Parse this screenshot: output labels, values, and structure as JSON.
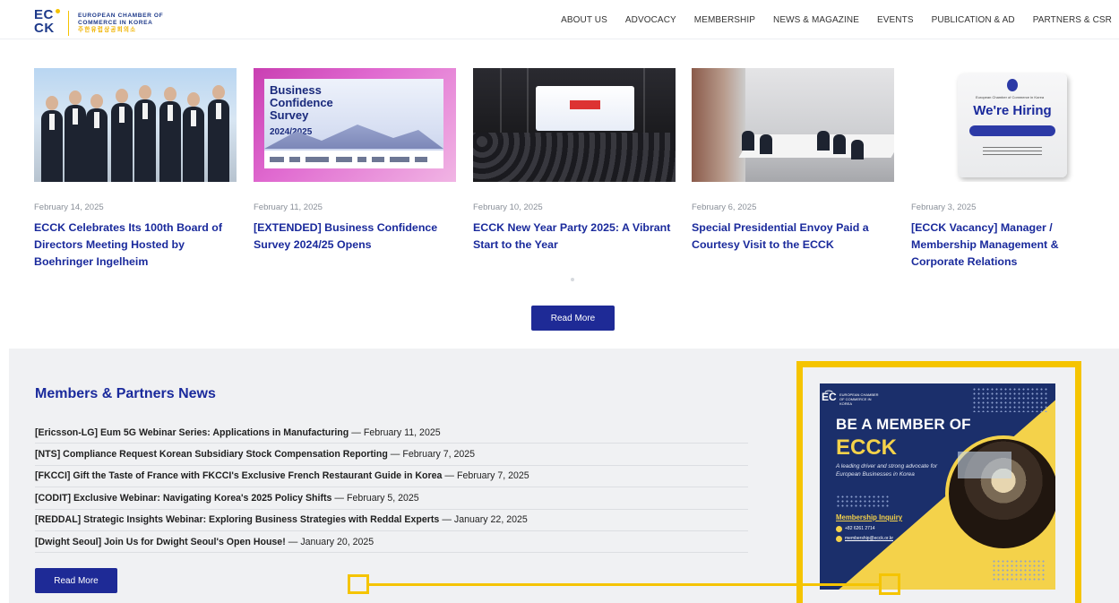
{
  "header": {
    "logo": {
      "mark_line1": "EC",
      "mark_line2": "CK",
      "text_line1": "EUROPEAN CHAMBER OF",
      "text_line2": "COMMERCE IN KOREA",
      "text_line3": "주한유럽상공회의소"
    },
    "nav": [
      {
        "label": "ABOUT US"
      },
      {
        "label": "ADVOCACY"
      },
      {
        "label": "MEMBERSHIP"
      },
      {
        "label": "NEWS & MAGAZINE"
      },
      {
        "label": "EVENTS"
      },
      {
        "label": "PUBLICATION & AD"
      },
      {
        "label": "PARTNERS & CSR"
      }
    ]
  },
  "news": {
    "cards": [
      {
        "date": "February 14, 2025",
        "title": "ECCK Celebrates Its 100th Board of Directors Meeting Hosted by Boehringer Ingelheim"
      },
      {
        "date": "February 11, 2025",
        "title": "[EXTENDED] Business Confidence Survey 2024/25 Opens",
        "image_text": {
          "line1": "Business",
          "line2": "Confidence",
          "line3": "Survey",
          "year": "2024/2025"
        }
      },
      {
        "date": "February 10, 2025",
        "title": "ECCK New Year Party 2025: A Vibrant Start to the Year"
      },
      {
        "date": "February 6, 2025",
        "title": "Special Presidential Envoy Paid a Courtesy Visit to the ECCK"
      },
      {
        "date": "February 3, 2025",
        "title": "[ECCK Vacancy] Manager / Membership Management & Corporate Relations",
        "image_text": {
          "small": "European Chamber of Commerce in Korea",
          "headline": "We're Hiring"
        }
      }
    ],
    "read_more": "Read More"
  },
  "members": {
    "title": "Members & Partners News",
    "items": [
      {
        "title": "[Ericsson-LG] Eum 5G Webinar Series: Applications in Manufacturing",
        "date": "February 11, 2025"
      },
      {
        "title": "[NTS] Compliance Request Korean Subsidiary Stock Compensation Reporting",
        "date": "February 7, 2025"
      },
      {
        "title": "[FKCCI] Gift the Taste of France with FKCCI's Exclusive French Restaurant Guide in Korea",
        "date": "February 7, 2025"
      },
      {
        "title": "[CODIT] Exclusive Webinar: Navigating Korea's 2025 Policy Shifts",
        "date": "February 5, 2025"
      },
      {
        "title": "[REDDAL] Strategic Insights Webinar: Exploring Business Strategies with Reddal Experts",
        "date": "January 22, 2025"
      },
      {
        "title": "[Dwight Seoul] Join Us for Dwight Seoul's Open House!",
        "date": "January 20, 2025"
      }
    ],
    "separator": "—",
    "read_more": "Read More"
  },
  "banner": {
    "logo_mark": "E͡C",
    "logo_text": "EUROPEAN CHAMBER OF COMMERCE IN KOREA",
    "headline": "BE A MEMBER OF",
    "brand": "ECCK",
    "subtitle": "A leading driver and strong advocate for European Businesses in Korea",
    "inquiry": "Membership Inquiry",
    "phone": "+82 6261 2714",
    "email": "membership@ecck.or.kr"
  },
  "colors": {
    "primary": "#1e2a96",
    "title_blue": "#1a2a9c",
    "highlight": "#f5c400",
    "banner_navy": "#1b2f6b",
    "banner_yellow": "#f4d24a",
    "section_bg": "#f0f1f3"
  }
}
